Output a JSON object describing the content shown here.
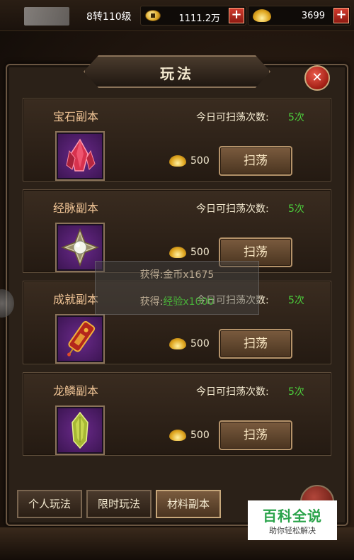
{
  "topbar": {
    "level": "8转110级",
    "coins": "1111.2万",
    "ingots": "3699"
  },
  "panel": {
    "title": "玩法"
  },
  "dungeons": [
    {
      "name": "宝石副本",
      "quota_label": "今日可扫荡次数:",
      "quota_value": "5次",
      "cost": "500",
      "button": "扫荡",
      "item": "red-crystal"
    },
    {
      "name": "经脉副本",
      "quota_label": "今日可扫荡次数:",
      "quota_value": "5次",
      "cost": "500",
      "button": "扫荡",
      "item": "pearl-star"
    },
    {
      "name": "成就副本",
      "quota_label": "今日可扫荡次数:",
      "quota_value": "5次",
      "cost": "500",
      "button": "扫荡",
      "item": "token-plaque"
    },
    {
      "name": "龙鳞副本",
      "quota_label": "今日可扫荡次数:",
      "quota_value": "5次",
      "cost": "500",
      "button": "扫荡",
      "item": "green-scale"
    }
  ],
  "toast": {
    "line1": "获得:金币x1675",
    "line2_prefix": "获得:",
    "line2_green": "经验x1000"
  },
  "tabs": [
    {
      "label": "个人玩法",
      "active": false
    },
    {
      "label": "限时玩法",
      "active": false
    },
    {
      "label": "材料副本",
      "active": true
    }
  ],
  "watermark": {
    "title": "百科全说",
    "subtitle": "助你轻松解决"
  }
}
